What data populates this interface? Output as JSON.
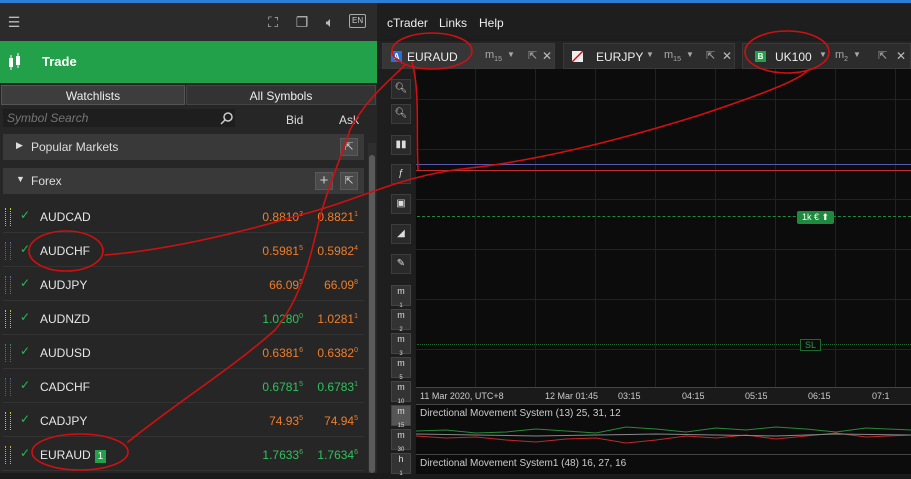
{
  "left": {
    "trade_title": "Trade",
    "tabs": {
      "watchlists": "Watchlists",
      "all_symbols": "All Symbols"
    },
    "search_placeholder": "Symbol Search",
    "col_bid": "Bid",
    "col_ask": "Ask",
    "lang": "EN",
    "groups": {
      "popular": "Popular Markets",
      "forex": "Forex"
    },
    "rows": [
      {
        "symbol": "AUDCAD",
        "bid": "0.8810",
        "bid_sup": "3",
        "ask": "0.8821",
        "ask_sup": "1",
        "color": "orange"
      },
      {
        "symbol": "AUDCHF",
        "bid": "0.5981",
        "bid_sup": "5",
        "ask": "0.5982",
        "ask_sup": "4",
        "color": "orange"
      },
      {
        "symbol": "AUDJPY",
        "bid": "66.09",
        "bid_sup": "5",
        "ask": "66.09",
        "ask_sup": "8",
        "color": "orange"
      },
      {
        "symbol": "AUDNZD",
        "bid": "1.0280",
        "bid_sup": "0",
        "ask": "1.0281",
        "ask_sup": "1",
        "color": "mixed"
      },
      {
        "symbol": "AUDUSD",
        "bid": "0.6381",
        "bid_sup": "6",
        "ask": "0.6382",
        "ask_sup": "0",
        "color": "orange"
      },
      {
        "symbol": "CADCHF",
        "bid": "0.6781",
        "bid_sup": "5",
        "ask": "0.6783",
        "ask_sup": "1",
        "color": "green"
      },
      {
        "symbol": "CADJPY",
        "bid": "74.93",
        "bid_sup": "5",
        "ask": "74.94",
        "ask_sup": "5",
        "color": "orange"
      },
      {
        "symbol": "EURAUD",
        "badge": "1",
        "bid": "1.7633",
        "bid_sup": "6",
        "ask": "1.7634",
        "ask_sup": "6",
        "color": "green"
      }
    ]
  },
  "menu": {
    "ctrader": "cTrader",
    "links": "Links",
    "help": "Help"
  },
  "chart_tabs": [
    {
      "icon": "A",
      "symbol": "EURAUD",
      "tf": "m",
      "tf_sub": "15"
    },
    {
      "icon": "",
      "symbol": "EURJPY",
      "tf": "m",
      "tf_sub": "15"
    },
    {
      "icon": "B",
      "symbol": "UK100",
      "tf": "m",
      "tf_sub": "2"
    }
  ],
  "tools": {
    "timeframes": [
      {
        "m": "m",
        "n": "1"
      },
      {
        "m": "m",
        "n": "2"
      },
      {
        "m": "m",
        "n": "3"
      },
      {
        "m": "m",
        "n": "5"
      },
      {
        "m": "m",
        "n": "10"
      },
      {
        "m": "m",
        "n": "15"
      },
      {
        "m": "m",
        "n": "30"
      },
      {
        "m": "h",
        "n": "1"
      }
    ]
  },
  "chart": {
    "tp_label": "1k € ⬆",
    "sl_label": "SL",
    "time_ticks": [
      "11 Mar 2020, UTC+8",
      "12 Mar 01:45",
      "03:15",
      "04:15",
      "05:15",
      "06:15",
      "07:1"
    ],
    "indicator1": "Directional Movement System (13) 25, 31, 12",
    "indicator2": "Directional Movement System1 (48) 16, 27, 16"
  },
  "colors": {
    "accent": "#22a04a",
    "bid_ask_orange": "#f07d2a",
    "bid_ask_green": "#2dc35a",
    "annotation": "#d01010"
  }
}
